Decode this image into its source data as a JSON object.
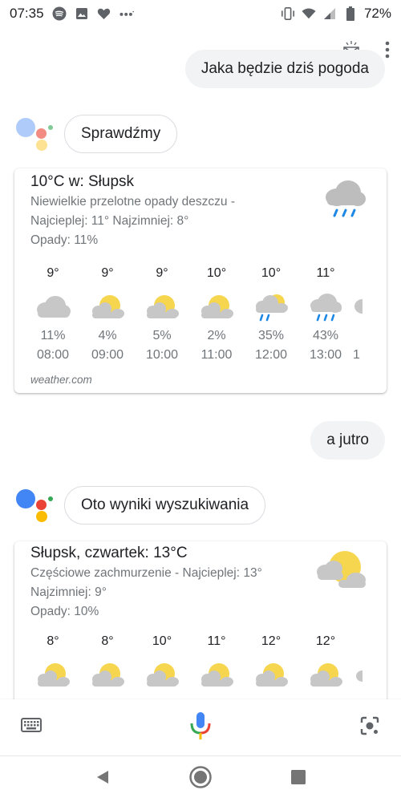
{
  "status_bar": {
    "time": "07:35",
    "battery": "72%",
    "left_icons": [
      "spotify-icon",
      "image-icon",
      "heart-icon",
      "more-dots-icon"
    ],
    "right_icons": [
      "vibrate-icon",
      "wifi-icon",
      "signal-icon",
      "battery-icon"
    ]
  },
  "conversation": {
    "query1": "Jaka będzie dziś pogoda",
    "reply1": "Sprawdźmy",
    "query2": "a jutro",
    "reply2": "Oto wyniki wyszukiwania"
  },
  "card_today": {
    "title": "10°C w: Słupsk",
    "line1": "Niewielkie przelotne opady deszczu -",
    "line2": "Najcieplej: 11° Najzimniej: 8°",
    "line3": "Opady: 11%",
    "source": "weather.com",
    "main_icon": "cloud-rain-icon",
    "hours": [
      {
        "temp": "9°",
        "icon": "cloudy-icon",
        "pct": "11%",
        "time": "08:00"
      },
      {
        "temp": "9°",
        "icon": "partly-cloudy-icon",
        "pct": "4%",
        "time": "09:00"
      },
      {
        "temp": "9°",
        "icon": "partly-cloudy-icon",
        "pct": "5%",
        "time": "10:00"
      },
      {
        "temp": "10°",
        "icon": "partly-cloudy-icon",
        "pct": "2%",
        "time": "11:00"
      },
      {
        "temp": "10°",
        "icon": "sun-rain-icon",
        "pct": "35%",
        "time": "12:00"
      },
      {
        "temp": "11°",
        "icon": "cloud-rain-icon",
        "pct": "43%",
        "time": "13:00"
      },
      {
        "temp": "",
        "icon": "cloud-rain-icon",
        "pct": "",
        "time": "1"
      }
    ]
  },
  "card_tomorrow": {
    "title": "Słupsk, czwartek: 13°C",
    "line1": "Częściowe zachmurzenie - Najcieplej: 13°",
    "line2": "Najzimniej: 9°",
    "line3": "Opady: 10%",
    "main_icon": "partly-cloudy-icon",
    "hours": [
      {
        "temp": "8°",
        "icon": "partly-cloudy-icon"
      },
      {
        "temp": "8°",
        "icon": "partly-cloudy-icon"
      },
      {
        "temp": "10°",
        "icon": "partly-cloudy-icon"
      },
      {
        "temp": "11°",
        "icon": "partly-cloudy-icon"
      },
      {
        "temp": "12°",
        "icon": "partly-cloudy-icon"
      },
      {
        "temp": "12°",
        "icon": "partly-cloudy-icon"
      },
      {
        "temp": "",
        "icon": "partly-cloudy-icon"
      }
    ]
  },
  "bottom_bar": {
    "left_icon": "keyboard-icon",
    "center_icon": "microphone-icon",
    "right_icon": "lens-icon"
  },
  "nav_bar": {
    "back_icon": "back-icon",
    "home_icon": "home-icon",
    "recents_icon": "recents-icon"
  },
  "colors": {
    "ga_blue": "#4285f4",
    "ga_red": "#ea4335",
    "ga_yellow": "#fbbc05",
    "ga_green": "#34a853",
    "cloud_gray": "#c7c7c7",
    "sun_yellow": "#f7d64f",
    "rain_blue": "#1e88e5"
  }
}
